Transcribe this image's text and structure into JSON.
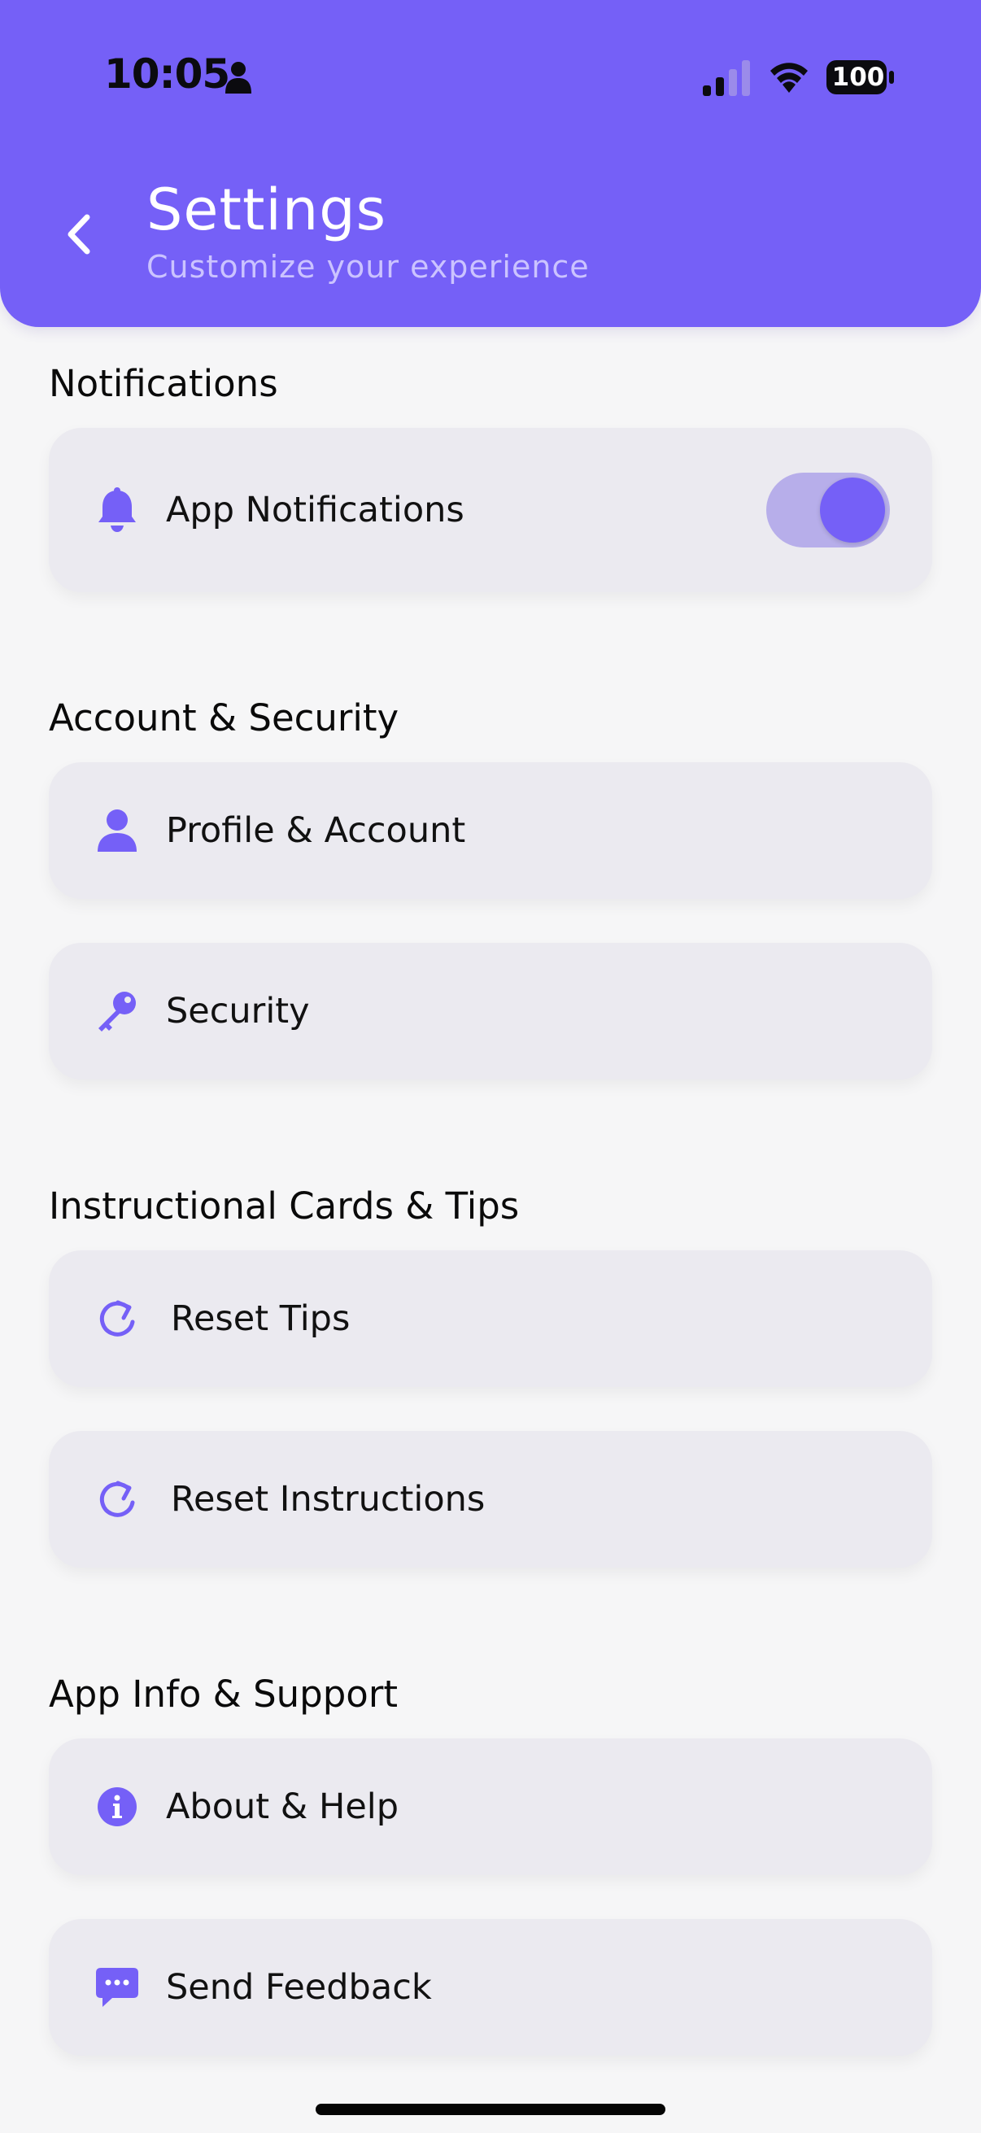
{
  "status_bar": {
    "time": "10:05",
    "battery": "100"
  },
  "header": {
    "title": "Settings",
    "subtitle": "Customize your experience"
  },
  "sections": [
    {
      "title": "Notifications",
      "items": [
        {
          "label": "App Notifications",
          "icon": "bell-icon",
          "toggle": "on"
        }
      ]
    },
    {
      "title": "Account & Security",
      "items": [
        {
          "label": "Profile & Account",
          "icon": "person-icon"
        },
        {
          "label": "Security",
          "icon": "key-icon"
        }
      ]
    },
    {
      "title": "Instructional Cards & Tips",
      "items": [
        {
          "label": "Reset Tips",
          "icon": "refresh-icon"
        },
        {
          "label": "Reset Instructions",
          "icon": "refresh-icon"
        }
      ]
    },
    {
      "title": "App Info & Support",
      "items": [
        {
          "label": "About & Help",
          "icon": "info-icon"
        },
        {
          "label": "Send Feedback",
          "icon": "message-icon"
        }
      ]
    }
  ],
  "colors": {
    "accent": "#7560f7",
    "background": "#f6f6f7",
    "card": "#ebeaf0",
    "toggle_track": "#b7aeea",
    "subtitle": "#cbc3ff"
  }
}
